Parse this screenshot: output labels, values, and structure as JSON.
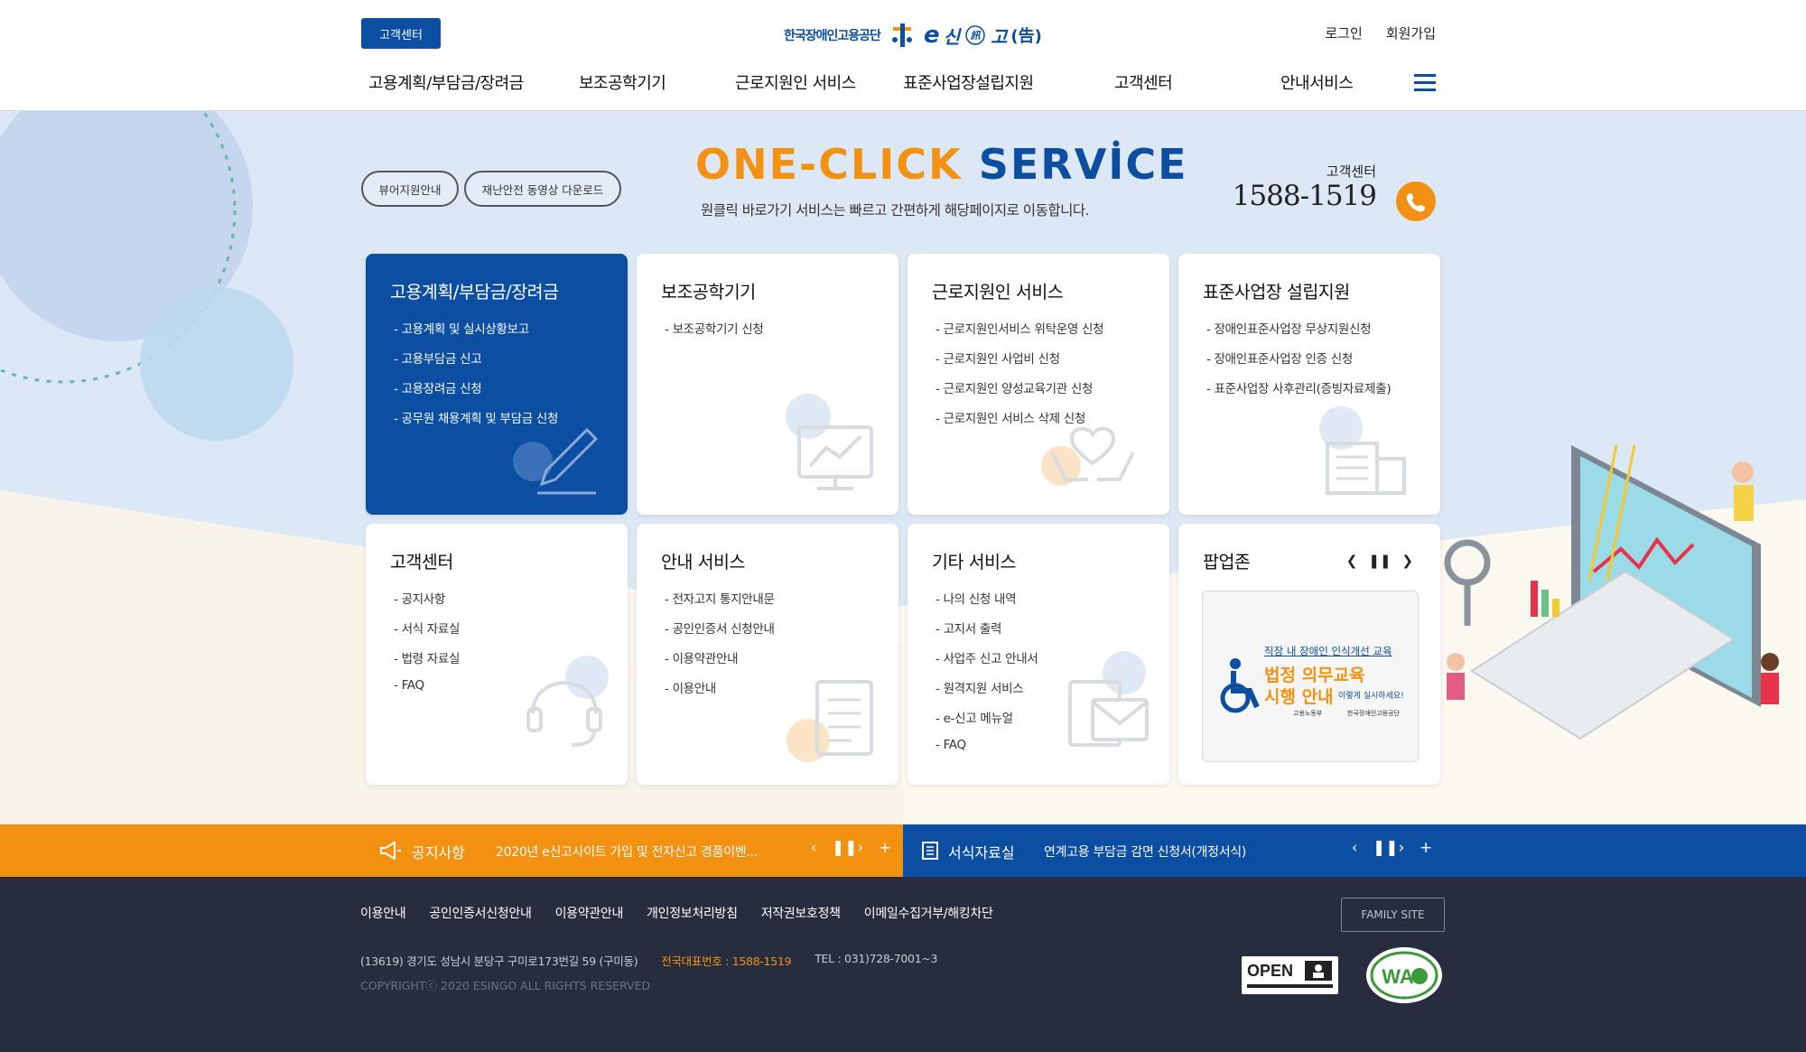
{
  "header": {
    "cs_button": "고객센터",
    "logo_org": "한국장애인고용공단",
    "logo_service": "신",
    "logo_service_2": "고",
    "logo_chars": "(告)",
    "login": "로그인",
    "signup": "회원가입",
    "gnb": [
      "고용계획/부담금/장려금",
      "보조공학기기",
      "근로지원인 서비스",
      "표준사업장설립지원",
      "고객센터",
      "안내서비스"
    ]
  },
  "hero": {
    "pill_1": "뷰어지원안내",
    "pill_2": "재난안전 동영상 다운로드",
    "title_orange": "ONE-CLICK",
    "title_blue": "SERVICE",
    "subtitle": "원클릭 바로가기 서비스는 빠르고 간편하게 해당페이지로 이동합니다.",
    "cs_label": "고객센터",
    "cs_phone": "1588-1519"
  },
  "cards": [
    {
      "title": "고용계획/부담금/장려금",
      "items": [
        "- 고용계획 및  실시상황보고",
        "- 고용부담금 신고",
        "- 고용장려금 신청",
        "- 공무원 채용계획 및 부담금 신청"
      ]
    },
    {
      "title": "보조공학기기",
      "items": [
        "- 보조공학기기 신청"
      ]
    },
    {
      "title": "근로지원인 서비스",
      "items": [
        "- 근로지원인서비스 위탁운영 신청",
        "- 근로지원인 사업비 신청",
        "- 근로지원인 양성교육기관 신청",
        "- 근로지원인 서비스 삭제 신청"
      ]
    },
    {
      "title": "표준사업장 설립지원",
      "items": [
        "- 장애인표준사업장 무상지원신청",
        "- 장애인표준사업장 인증 신청",
        "- 표준사업장 사후관리(증빙자료제출)"
      ]
    },
    {
      "title": "고객센터",
      "items": [
        "- 공지사항",
        "- 서식 자료실",
        "- 법령 자료실",
        "- FAQ"
      ]
    },
    {
      "title": "안내 서비스",
      "items": [
        "- 전자고지 통지안내문",
        "- 공인인증서 신청안내",
        "- 이용약관안내",
        "- 이용안내"
      ]
    },
    {
      "title": "기타 서비스",
      "items": [
        "- 나의 신청 내역",
        "- 고지서 출력",
        "- 사업주 신고 안내서",
        "- 원격지원 서비스",
        "- e-신고 메뉴얼",
        "- FAQ"
      ]
    }
  ],
  "popup": {
    "title": "팝업존",
    "banner_line1": "직장 내 장애인 인식개선 교육",
    "banner_line2": "법정 의무교육",
    "banner_line3": "시행 안내",
    "banner_note": "이렇게 실시하세요!",
    "banner_org1": "고용노동부",
    "banner_org2": "한국장애인고용공단"
  },
  "notice": {
    "title": "공지사항",
    "text": "2020년 e신고사이트 가입 및 전자신고 경품이벤...",
    "forms_title": "서식자료실",
    "forms_text": "연계고용 부담금 감면 신청서(개정서식)"
  },
  "footer": {
    "links": [
      "이용안내",
      "공인인증서신청안내",
      "이용약관안내",
      "개인정보처리방침",
      "저작권보호정책",
      "이메일수집거부/해킹차단"
    ],
    "family_site": "FAMILY SITE",
    "address": "(13619) 경기도 성남시 분당구 구미로173번길 59 (구미동)",
    "rep_phone": "전국대표번호 : 1588-1519",
    "tel": "TEL : 031)728-7001~3",
    "copyright": "COPYRIGHTⓒ 2020 ESINGO ALL RIGHTS RESERVED",
    "open_badge": "OPEN",
    "wa_badge": "WA"
  },
  "colors": {
    "brand_blue": "#0b4ea2",
    "brand_orange": "#f39112",
    "footer_bg": "#272c3e",
    "hero_bg": "#dde8f6"
  }
}
